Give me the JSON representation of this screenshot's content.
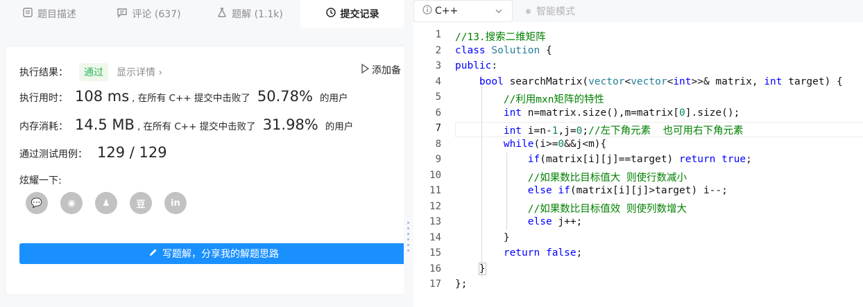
{
  "tabs": [
    {
      "label": "题目描述",
      "icon": "description-icon"
    },
    {
      "label": "评论 (637)",
      "icon": "comment-icon"
    },
    {
      "label": "题解 (1.1k)",
      "icon": "flask-icon"
    },
    {
      "label": "提交记录",
      "icon": "history-icon"
    }
  ],
  "result": {
    "label": "执行结果：",
    "status": "通过",
    "details_label": "显示详情",
    "add_note_label": "添加备",
    "runtime_label": "执行用时：",
    "runtime_value": "108 ms",
    "runtime_text": ", 在所有 C++ 提交中击败了",
    "runtime_percent": "50.78%",
    "users_suffix": "的用户",
    "memory_label": "内存消耗：",
    "memory_value": "14.5 MB",
    "memory_text": ", 在所有 C++ 提交中击败了",
    "memory_percent": "31.98%",
    "tests_label": "通过测试用例：",
    "tests_value": "129 / 129",
    "share_label": "炫耀一下:",
    "write_button_label": "写题解，分享我的解题思路"
  },
  "share_icons": [
    {
      "name": "wechat-icon",
      "glyph": "💬"
    },
    {
      "name": "weibo-icon",
      "glyph": "◉"
    },
    {
      "name": "qq-icon",
      "glyph": "♟"
    },
    {
      "name": "douban-icon",
      "glyph": "豆"
    },
    {
      "name": "linkedin-icon",
      "glyph": "in"
    }
  ],
  "toolbar": {
    "language": "C++",
    "mode_label": "智能模式"
  },
  "code": {
    "line_numbers": [
      "1",
      "2",
      "3",
      "4",
      "5",
      "6",
      "7",
      "8",
      "9",
      "10",
      "11",
      "12",
      "13",
      "14",
      "15",
      "16",
      "17"
    ],
    "current_line": 7
  },
  "colors": {
    "accent": "#1a90ff",
    "pass_green": "#2db55d",
    "keyword": "#0000ff",
    "type": "#267f99",
    "number": "#098658",
    "comment": "#008000"
  }
}
